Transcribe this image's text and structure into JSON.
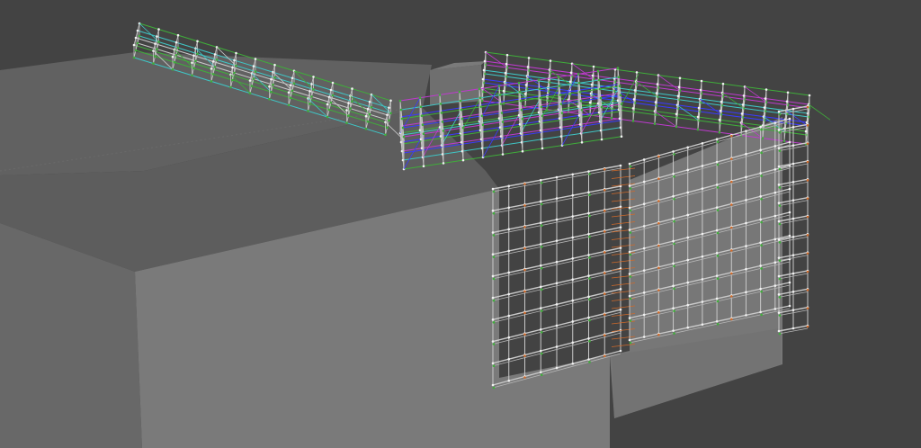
{
  "viewport": {
    "background": "#434343",
    "model_kind": "building-with-scaffolding"
  },
  "colors": {
    "roof_far": "#616161",
    "roof_near": "#5e5e5e",
    "wall_left": "#6d6d6d",
    "wall_front": "#7d7d7d",
    "wall_front_right": "#7a7a7a",
    "scaffold_frame": "#c9c9c9",
    "scaffold_deck_green": "#3fae3a",
    "scaffold_brace_cyan": "#3fc6c6",
    "scaffold_brace_blue": "#3a3aff",
    "scaffold_brace_magenta": "#c03ad0",
    "scaffold_base_orange": "#d06a2a",
    "node_white": "#f2f2f2"
  }
}
